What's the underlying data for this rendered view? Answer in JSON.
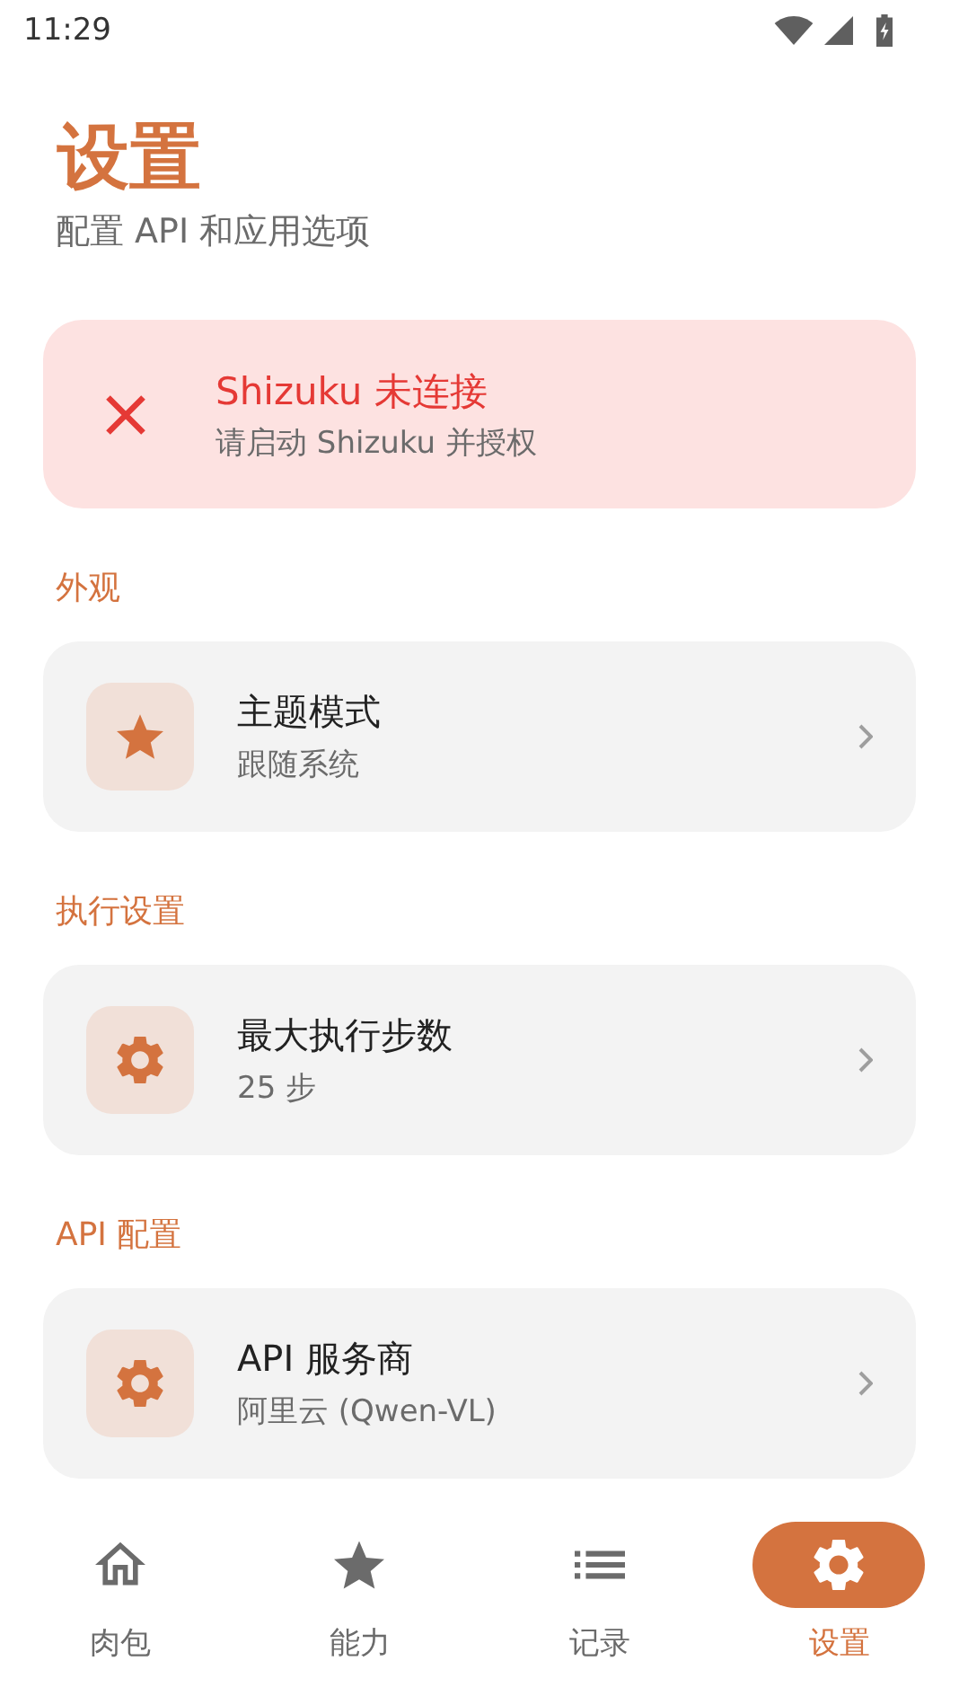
{
  "status_bar": {
    "time": "11:29"
  },
  "header": {
    "title": "设置",
    "subtitle": "配置 API 和应用选项"
  },
  "alert": {
    "title": "Shizuku 未连接",
    "message": "请启动 Shizuku 并授权"
  },
  "sections": [
    {
      "title": "外观",
      "items": [
        {
          "title": "主题模式",
          "value": "跟随系统"
        }
      ]
    },
    {
      "title": "执行设置",
      "items": [
        {
          "title": "最大执行步数",
          "value": "25 步"
        }
      ]
    },
    {
      "title": "API 配置",
      "items": [
        {
          "title": "API 服务商",
          "value": "阿里云 (Qwen-VL)"
        }
      ]
    }
  ],
  "nav": [
    {
      "label": "肉包",
      "selected": false
    },
    {
      "label": "能力",
      "selected": false
    },
    {
      "label": "记录",
      "selected": false
    },
    {
      "label": "设置",
      "selected": true
    }
  ]
}
